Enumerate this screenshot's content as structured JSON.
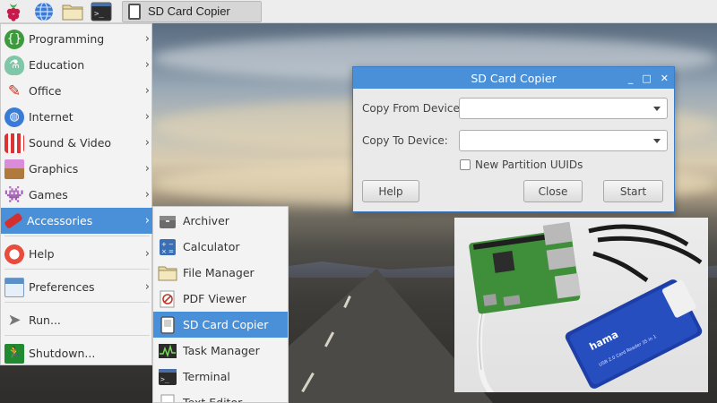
{
  "taskbar": {
    "task_button_label": "SD Card Copier",
    "icons": [
      "raspberry-icon",
      "web-browser-icon",
      "file-manager-icon",
      "terminal-icon"
    ]
  },
  "menu": {
    "items": [
      {
        "label": "Programming",
        "icon": "programming-icon",
        "has_submenu": true
      },
      {
        "label": "Education",
        "icon": "education-icon",
        "has_submenu": true
      },
      {
        "label": "Office",
        "icon": "office-icon",
        "has_submenu": true
      },
      {
        "label": "Internet",
        "icon": "internet-icon",
        "has_submenu": true
      },
      {
        "label": "Sound & Video",
        "icon": "sound-video-icon",
        "has_submenu": true
      },
      {
        "label": "Graphics",
        "icon": "graphics-icon",
        "has_submenu": true
      },
      {
        "label": "Games",
        "icon": "games-icon",
        "has_submenu": true
      },
      {
        "label": "Accessories",
        "icon": "accessories-icon",
        "has_submenu": true,
        "active": true
      },
      {
        "label": "Help",
        "icon": "help-icon",
        "has_submenu": true
      },
      {
        "label": "Preferences",
        "icon": "preferences-icon",
        "has_submenu": true
      },
      {
        "label": "Run...",
        "icon": "run-icon",
        "has_submenu": false
      },
      {
        "label": "Shutdown...",
        "icon": "shutdown-icon",
        "has_submenu": false
      }
    ],
    "arrow": "›"
  },
  "submenu": {
    "items": [
      {
        "label": "Archiver",
        "icon": "archiver-icon"
      },
      {
        "label": "Calculator",
        "icon": "calculator-icon"
      },
      {
        "label": "File Manager",
        "icon": "file-manager-icon"
      },
      {
        "label": "PDF Viewer",
        "icon": "pdf-viewer-icon"
      },
      {
        "label": "SD Card Copier",
        "icon": "sd-card-copier-icon",
        "active": true
      },
      {
        "label": "Task Manager",
        "icon": "task-manager-icon"
      },
      {
        "label": "Terminal",
        "icon": "terminal-icon"
      },
      {
        "label": "Text Editor",
        "icon": "text-editor-icon"
      }
    ]
  },
  "dialog": {
    "title": "SD Card Copier",
    "controls": {
      "minimize": "_",
      "maximize": "□",
      "close": "✕"
    },
    "copy_from_label": "Copy From Device:",
    "copy_from_value": "",
    "copy_to_label": "Copy To Device:",
    "copy_to_value": "",
    "new_partition_uuids_label": "New Partition UUIDs",
    "new_partition_uuids_checked": false,
    "help_label": "Help",
    "close_label": "Close",
    "start_label": "Start"
  },
  "photo": {
    "card_reader_brand": "hama",
    "card_reader_text": "USB 2.0 Card Reader 35 in 1"
  },
  "colors": {
    "accent": "#4a90d9",
    "menu_bg": "#f3f3f3",
    "dialog_bg": "#eaeaea"
  }
}
